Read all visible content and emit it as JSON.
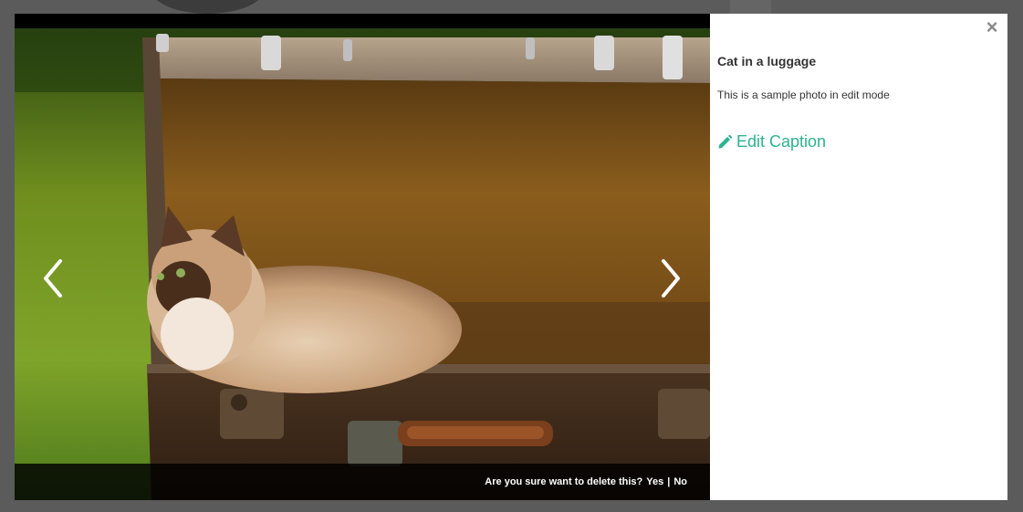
{
  "lightbox": {
    "photo_alt": "Cat in a luggage",
    "nav": {
      "prev_icon": "chevron-left-icon",
      "next_icon": "chevron-right-icon"
    },
    "delete_confirm": {
      "question": "Are you sure want to delete this?",
      "yes": "Yes",
      "separator": "|",
      "no": "No"
    }
  },
  "panel": {
    "close_icon": "close-icon",
    "close_glyph": "×",
    "title": "Cat in a luggage",
    "description": "This is a sample photo in edit mode",
    "edit_icon": "pencil-icon",
    "edit_label": "Edit Caption",
    "accent_color": "#2db38f"
  }
}
